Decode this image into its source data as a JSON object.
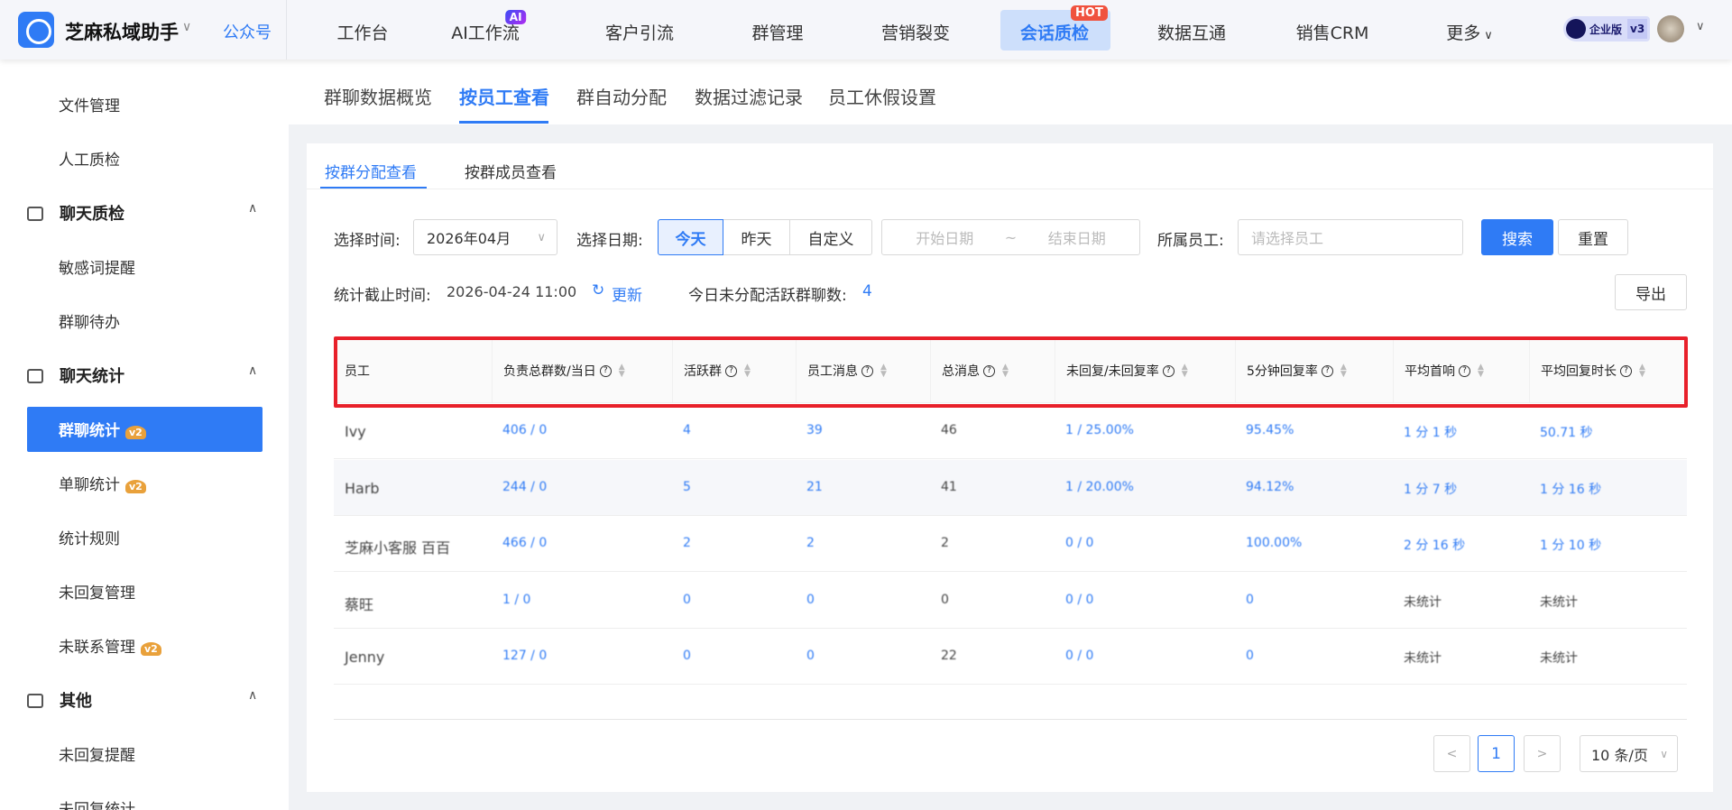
{
  "brand": {
    "name": "芝麻私域助手",
    "account": "公众号"
  },
  "nav": [
    {
      "label": "工作台"
    },
    {
      "label": "AI工作流",
      "badge": "AI"
    },
    {
      "label": "客户引流"
    },
    {
      "label": "群管理"
    },
    {
      "label": "营销裂变"
    },
    {
      "label": "会话质检",
      "badge": "HOT",
      "active": true
    },
    {
      "label": "数据互通"
    },
    {
      "label": "销售CRM"
    },
    {
      "label": "更多"
    }
  ],
  "user": {
    "edition": "企业版",
    "version": "v3"
  },
  "sidebar": [
    {
      "type": "item",
      "label": "文件管理"
    },
    {
      "type": "item",
      "label": "人工质检"
    },
    {
      "type": "section",
      "label": "聊天质检"
    },
    {
      "type": "item",
      "label": "敏感词提醒"
    },
    {
      "type": "item",
      "label": "群聊待办"
    },
    {
      "type": "section",
      "label": "聊天统计"
    },
    {
      "type": "item",
      "label": "群聊统计",
      "badge": "v2",
      "active": true
    },
    {
      "type": "item",
      "label": "单聊统计",
      "badge": "v2"
    },
    {
      "type": "item",
      "label": "统计规则"
    },
    {
      "type": "item",
      "label": "未回复管理"
    },
    {
      "type": "item",
      "label": "未联系管理",
      "badge": "v2"
    },
    {
      "type": "section",
      "label": "其他"
    },
    {
      "type": "item",
      "label": "未回复提醒"
    },
    {
      "type": "item",
      "label": "未回复统计"
    }
  ],
  "tabs": [
    {
      "label": "群聊数据概览"
    },
    {
      "label": "按员工查看",
      "active": true
    },
    {
      "label": "群自动分配"
    },
    {
      "label": "数据过滤记录"
    },
    {
      "label": "员工休假设置"
    }
  ],
  "subtabs": [
    {
      "label": "按群分配查看",
      "active": true
    },
    {
      "label": "按群成员查看"
    }
  ],
  "filters": {
    "time_label": "选择时间:",
    "time_value": "2026年04月",
    "date_label": "选择日期:",
    "date_options": [
      "今天",
      "昨天",
      "自定义"
    ],
    "start_placeholder": "开始日期",
    "range_sep": "~",
    "end_placeholder": "结束日期",
    "staff_label": "所属员工:",
    "staff_placeholder": "请选择员工",
    "search": "搜索",
    "reset": "重置"
  },
  "stats": {
    "cutoff_label": "统计截止时间:",
    "cutoff_value": "2026-04-24 11:00",
    "refresh": "更新",
    "unassigned_label": "今日未分配活跃群聊数:",
    "unassigned_value": "4",
    "export": "导出"
  },
  "table": {
    "columns": [
      "员工",
      "负责总群数/当日",
      "活跃群",
      "员工消息",
      "总消息",
      "未回复/未回复率",
      "5分钟回复率",
      "平均首响",
      "平均回复时长"
    ],
    "rows": [
      [
        "Ivy",
        "406 / 0",
        "4",
        "39",
        "46",
        "1 / 25.00%",
        "95.45%",
        "1 分 1 秒",
        "50.71 秒"
      ],
      [
        "Harb",
        "244 / 0",
        "5",
        "21",
        "41",
        "1 / 20.00%",
        "94.12%",
        "1 分 7 秒",
        "1 分 16 秒"
      ],
      [
        "芝麻小客服 百百",
        "466 / 0",
        "2",
        "2",
        "2",
        "0 / 0",
        "100.00%",
        "2 分 16 秒",
        "1 分 10 秒"
      ],
      [
        "蔡旺",
        "1 / 0",
        "0",
        "0",
        "0",
        "0 / 0",
        "0",
        "未统计",
        "未统计"
      ],
      [
        "Jenny",
        "127 / 0",
        "0",
        "0",
        "22",
        "0 / 0",
        "0",
        "未统计",
        "未统计"
      ]
    ]
  },
  "pagination": {
    "current": "1",
    "page_size": "10 条/页"
  },
  "colors": {
    "primary": "#2f7bf5",
    "highlight": "#e8202a"
  }
}
